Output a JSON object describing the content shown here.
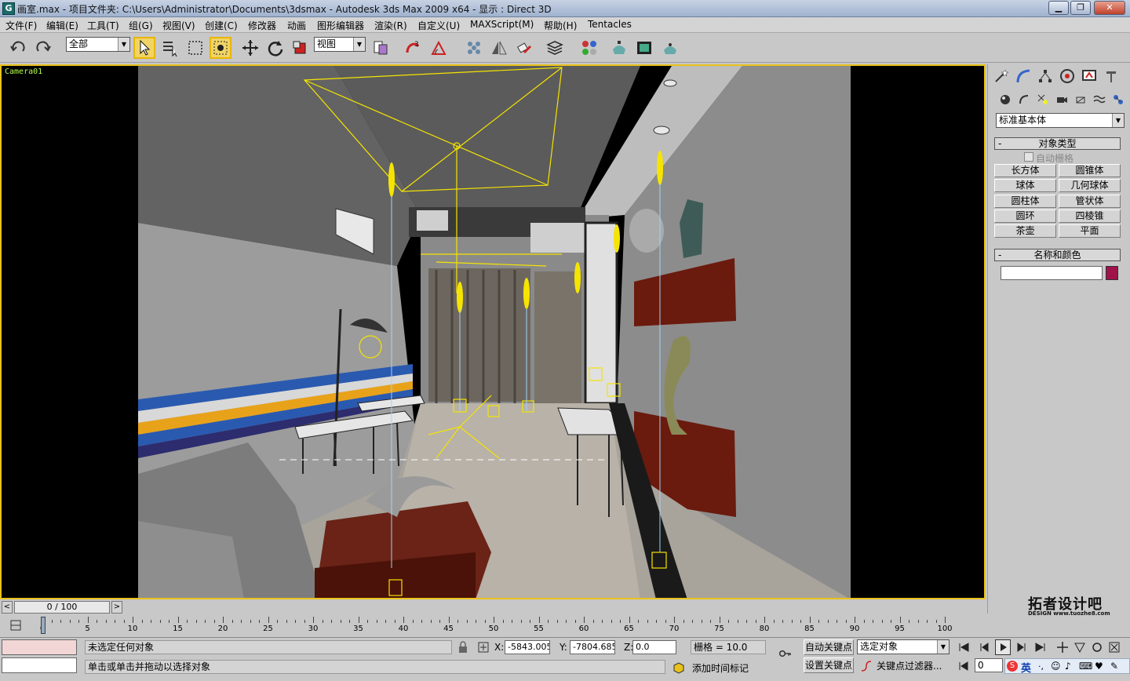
{
  "window": {
    "app_icon": "3ds-max-icon",
    "title": "画室.max    - 项目文件夹: C:\\Users\\Administrator\\Documents\\3dsmax    - Autodesk 3ds Max  2009 x64    - 显示 : Direct 3D",
    "min_label": "▁",
    "max_label": "❐",
    "close_label": "✕"
  },
  "menu": {
    "items": [
      "文件(F)",
      "编辑(E)",
      "工具(T)",
      "组(G)",
      "视图(V)",
      "创建(C)",
      "修改器",
      "动画",
      "图形编辑器",
      "渲染(R)",
      "自定义(U)",
      "MAXScript(M)",
      "帮助(H)",
      "Tentacles"
    ]
  },
  "toolbar": {
    "selection_filter": "全部",
    "ref_coord": "视图",
    "snap_label": "3"
  },
  "viewport": {
    "label": "Camera01"
  },
  "command_panel": {
    "dropdown": "标准基本体",
    "object_type_title": "对象类型",
    "auto_grid": "自动栅格",
    "buttons": [
      "长方体",
      "圆锥体",
      "球体",
      "几何球体",
      "圆柱体",
      "管状体",
      "圆环",
      "四棱锥",
      "茶壶",
      "平面"
    ],
    "name_color_title": "名称和颜色",
    "name_value": "",
    "color": "#a0124a",
    "minus": "-"
  },
  "timeline": {
    "frame_display": "0 / 100",
    "ticks": [
      "0",
      "5",
      "10",
      "15",
      "20",
      "25",
      "30",
      "35",
      "40",
      "45",
      "50",
      "55",
      "60",
      "65",
      "70",
      "75",
      "80",
      "85",
      "90",
      "95",
      "100"
    ]
  },
  "status": {
    "selection": "未选定任何对象",
    "prompt": "单击或单击并拖动以选择对象",
    "x_label": "X:",
    "x_value": "-5843.005",
    "y_label": "Y:",
    "y_value": "-7804.685",
    "z_label": "Z:",
    "z_value": "0.0",
    "grid": "栅格 = 10.0",
    "add_time_tag": "添加时间标记",
    "auto_key": "自动关键点",
    "set_key": "设置关键点",
    "key_mode": "选定对象",
    "key_filters": "关键点过滤器...",
    "frame": "0",
    "ime": "英",
    "listener": ""
  },
  "watermark": {
    "title": "拓者设计吧",
    "sub": "DESIGN www.tuozhe8.com"
  },
  "colors": {
    "viewport_border": "#e8c21a",
    "light_gizmo": "#f5e400",
    "camera_label": "#b4ff4a"
  }
}
